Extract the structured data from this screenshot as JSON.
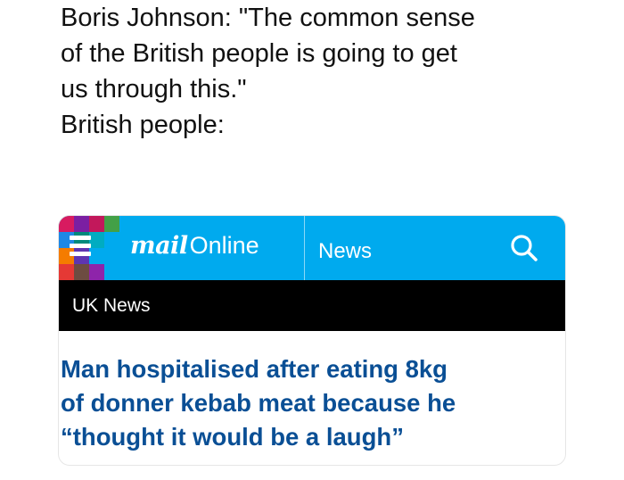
{
  "caption": {
    "lines": [
      "Boris Johnson: \"The common sense",
      "of the British people is going to get",
      "us through this.\"",
      "British people:"
    ]
  },
  "nav": {
    "logo_mail": "mail",
    "logo_online": "Online",
    "section": "News",
    "menu_icon": "hamburger-menu-icon",
    "search_icon": "search-icon",
    "brand_color": "#00aaee"
  },
  "subnav": {
    "label": "UK News"
  },
  "article": {
    "headline_lines": [
      "Man hospitalised after eating 8kg",
      "of donner kebab meat because he",
      "“thought it would be a laugh”"
    ],
    "headline_color": "#0a4f95"
  }
}
